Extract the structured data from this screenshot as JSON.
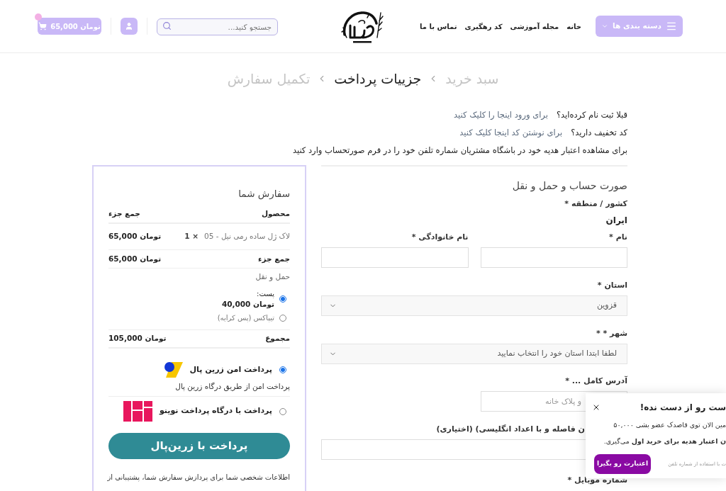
{
  "header": {
    "category_button": {
      "label": "دسته بندی ها"
    },
    "nav_links": [
      "خانه",
      "مجله آموزشی",
      "کد رهگیری",
      "تماس با ما"
    ],
    "search": {
      "placeholder": "جستجو کنید..."
    },
    "cart": {
      "total": "تومان 65,000"
    }
  },
  "breadcrumb": [
    {
      "label": "سبد خرید",
      "selected": false
    },
    {
      "label": "جزییات پرداخت",
      "selected": true
    },
    {
      "label": "تکمیل سفارش",
      "selected": false
    }
  ],
  "notices": [
    {
      "text": "قبلا ثبت نام کرده‌اید؟",
      "link": "برای ورود اینجا را کلیک کنید"
    },
    {
      "text": "کد تخفیف دارید؟",
      "link": "برای نوشتن کد اینجا کلیک کنید"
    },
    {
      "text": "برای مشاهده اعتبار هدیه خود در باشگاه مشتریان شماره تلفن خود را در فرم صورتحساب وارد کنید"
    }
  ],
  "billing": {
    "title": "صورت حساب و حمل و نقل",
    "fields": [
      {
        "kind": "static",
        "label": "کشور / منطقه *",
        "value": "ایران"
      },
      {
        "kind": "pair",
        "items": [
          {
            "label": "نام *"
          },
          {
            "label": "نام خانوادگی *"
          }
        ]
      },
      {
        "kind": "select",
        "label": "استان *",
        "value": "قزوین"
      },
      {
        "kind": "select",
        "label": "شهر * *",
        "value": "لطفا ابتدا استان خود را انتخاب نمایید"
      },
      {
        "kind": "half_text",
        "label": "آدرس کامل ... *",
        "placeholder": "و پلاک خانه"
      },
      {
        "kind": "wide_text",
        "label": "ن فاصله و با اعداد انگلیسی) (اختیاری)"
      },
      {
        "kind": "label",
        "label": "شماره موبایل *"
      }
    ]
  },
  "order": {
    "title": "سفارش شما",
    "columns": [
      "محصول",
      "جمع جزء"
    ],
    "items": [
      {
        "name": "لاک ژل ساده رمی نیل - 05",
        "quantity": "× 1",
        "total": "تومان 65,000"
      }
    ],
    "subtotal": {
      "label": "جمع جزء",
      "value": "تومان 65,000"
    },
    "shipping": {
      "label": "حمل و نقل",
      "options": [
        {
          "label": "پست:",
          "price": "تومان 40,000",
          "selected": true
        },
        {
          "label": "تیپاکس (پس کرایه)",
          "selected": false
        }
      ]
    },
    "total": {
      "label": "مجموع",
      "value": "تومان 105,000"
    }
  },
  "payment": {
    "methods": [
      {
        "kind": "stripe",
        "label": "پرداخت امن زرین پال",
        "selected": true,
        "description": "پرداخت امن از طریق درگاه زرین پال"
      },
      {
        "kind": "blocks",
        "label": "پرداخت با درگاه پرداخت نوینو",
        "selected": false
      }
    ],
    "submit": "پرداخت با زرین‌پال",
    "privacy": "اطلاعات شخصی شما برای پردازش سفارش شما، پشتیبانی از"
  },
  "popup": {
    "title": "ست رو از دست نده!",
    "lines": [
      "مین الان توی قاصدک عضو بشی ۵۰,۰۰۰",
      "**ن اعتبار هدیه برای خرید اول** می‌گیری."
    ],
    "button": "اعتبارت رو بگیرا",
    "note": "ت با استفاده از شماره تلفن"
  }
}
